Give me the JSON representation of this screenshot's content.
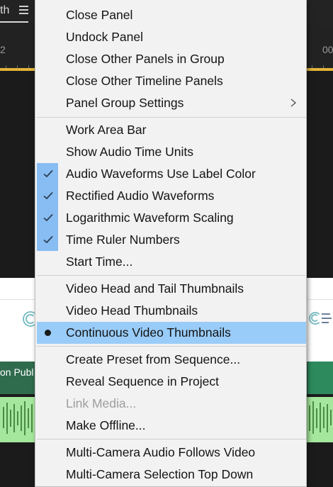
{
  "background": {
    "tab_fragment": "th",
    "ruler_left": "2",
    "ruler_right": "00",
    "clip_name": "on Publ"
  },
  "colors": {
    "menu_bg": "#f2f2f2",
    "check_gutter": "#88bdf3",
    "selected_row": "#99ccf8",
    "disabled_text": "#9d9d9d",
    "work_area_bar": "#e2b33b",
    "audio_clip": "#a5e79c"
  },
  "menu": {
    "items": [
      {
        "label": "Close Panel"
      },
      {
        "label": "Undock Panel"
      },
      {
        "label": "Close Other Panels in Group"
      },
      {
        "label": "Close Other Timeline Panels"
      },
      {
        "label": "Panel Group Settings",
        "submenu": true,
        "icon": "chevron-right-icon"
      },
      {
        "label": "Work Area Bar"
      },
      {
        "label": "Show Audio Time Units"
      },
      {
        "label": "Audio Waveforms Use Label Color",
        "checked": true
      },
      {
        "label": "Rectified Audio Waveforms",
        "checked": true
      },
      {
        "label": "Logarithmic Waveform Scaling",
        "checked": true
      },
      {
        "label": "Time Ruler Numbers",
        "checked": true
      },
      {
        "label": "Start Time..."
      },
      {
        "label": "Video Head and Tail Thumbnails"
      },
      {
        "label": "Video Head Thumbnails"
      },
      {
        "label": "Continuous Video Thumbnails",
        "selected": true,
        "icon": "radio-dot-icon"
      },
      {
        "label": "Create Preset from Sequence..."
      },
      {
        "label": "Reveal Sequence in Project"
      },
      {
        "label": "Link Media...",
        "disabled": true
      },
      {
        "label": "Make Offline..."
      },
      {
        "label": "Multi-Camera Audio Follows Video"
      },
      {
        "label": "Multi-Camera Selection Top Down"
      }
    ]
  }
}
